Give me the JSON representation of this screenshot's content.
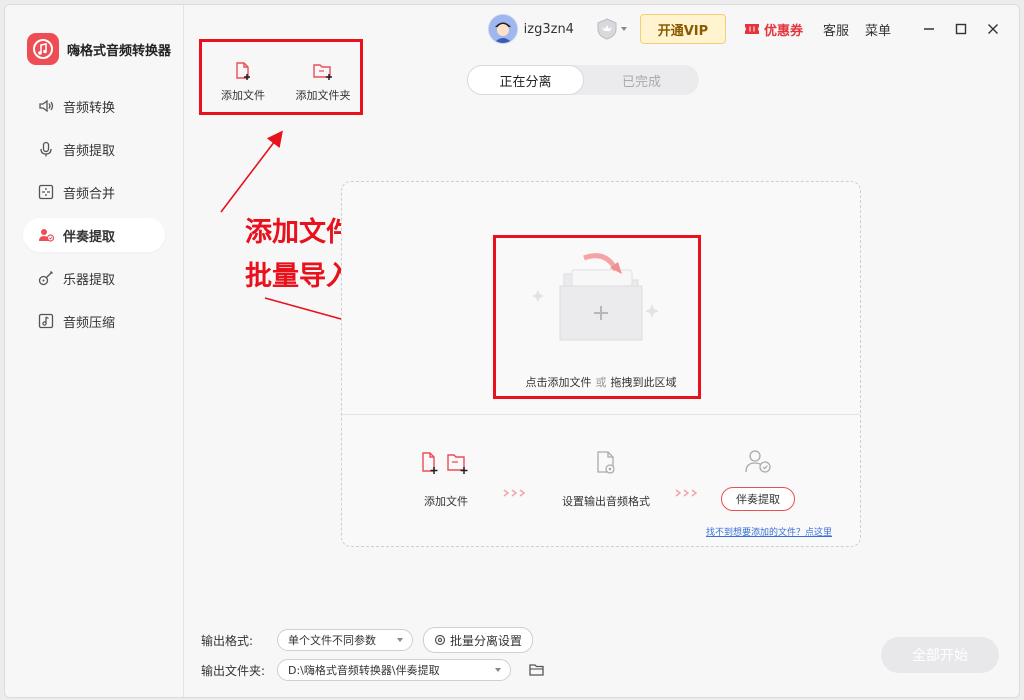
{
  "app": {
    "name": "嗨格式音频转换器"
  },
  "sidebar": {
    "items": [
      {
        "label": "音频转换",
        "icon": "speaker-icon",
        "active": false
      },
      {
        "label": "音频提取",
        "icon": "microphone-icon",
        "active": false
      },
      {
        "label": "音频合并",
        "icon": "merge-icon",
        "active": false
      },
      {
        "label": "伴奏提取",
        "icon": "accompaniment-icon",
        "active": true
      },
      {
        "label": "乐器提取",
        "icon": "guitar-icon",
        "active": false
      },
      {
        "label": "音频压缩",
        "icon": "compress-icon",
        "active": false
      }
    ]
  },
  "topbar": {
    "username": "izg3zn4",
    "vip_label": "开通VIP",
    "coupon_label": "优惠券",
    "service_label": "客服",
    "menu_label": "菜单"
  },
  "toolbar": {
    "add_file": "添加文件",
    "add_folder": "添加文件夹"
  },
  "tabs": {
    "processing": "正在分离",
    "done": "已完成"
  },
  "dropzone": {
    "hint_click": "点击添加文件",
    "hint_or": "或",
    "hint_drag": "拖拽到此区域",
    "step1": "添加文件",
    "step2": "设置输出音频格式",
    "step3": "伴奏提取",
    "help_link": "找不到想要添加的文件？点这里"
  },
  "annotation": {
    "line1": "添加文件，支持",
    "line2": "批量导入"
  },
  "bottom": {
    "format_label": "输出格式:",
    "format_value": "单个文件不同参数",
    "batch_label": "批量分离设置",
    "folder_label": "输出文件夹:",
    "folder_value": "D:\\嗨格式音频转换器\\伴奏提取",
    "start_label": "全部开始"
  },
  "colors": {
    "brand": "#ee4d55",
    "annotation": "#e8111c",
    "link": "#3a6fd8"
  }
}
